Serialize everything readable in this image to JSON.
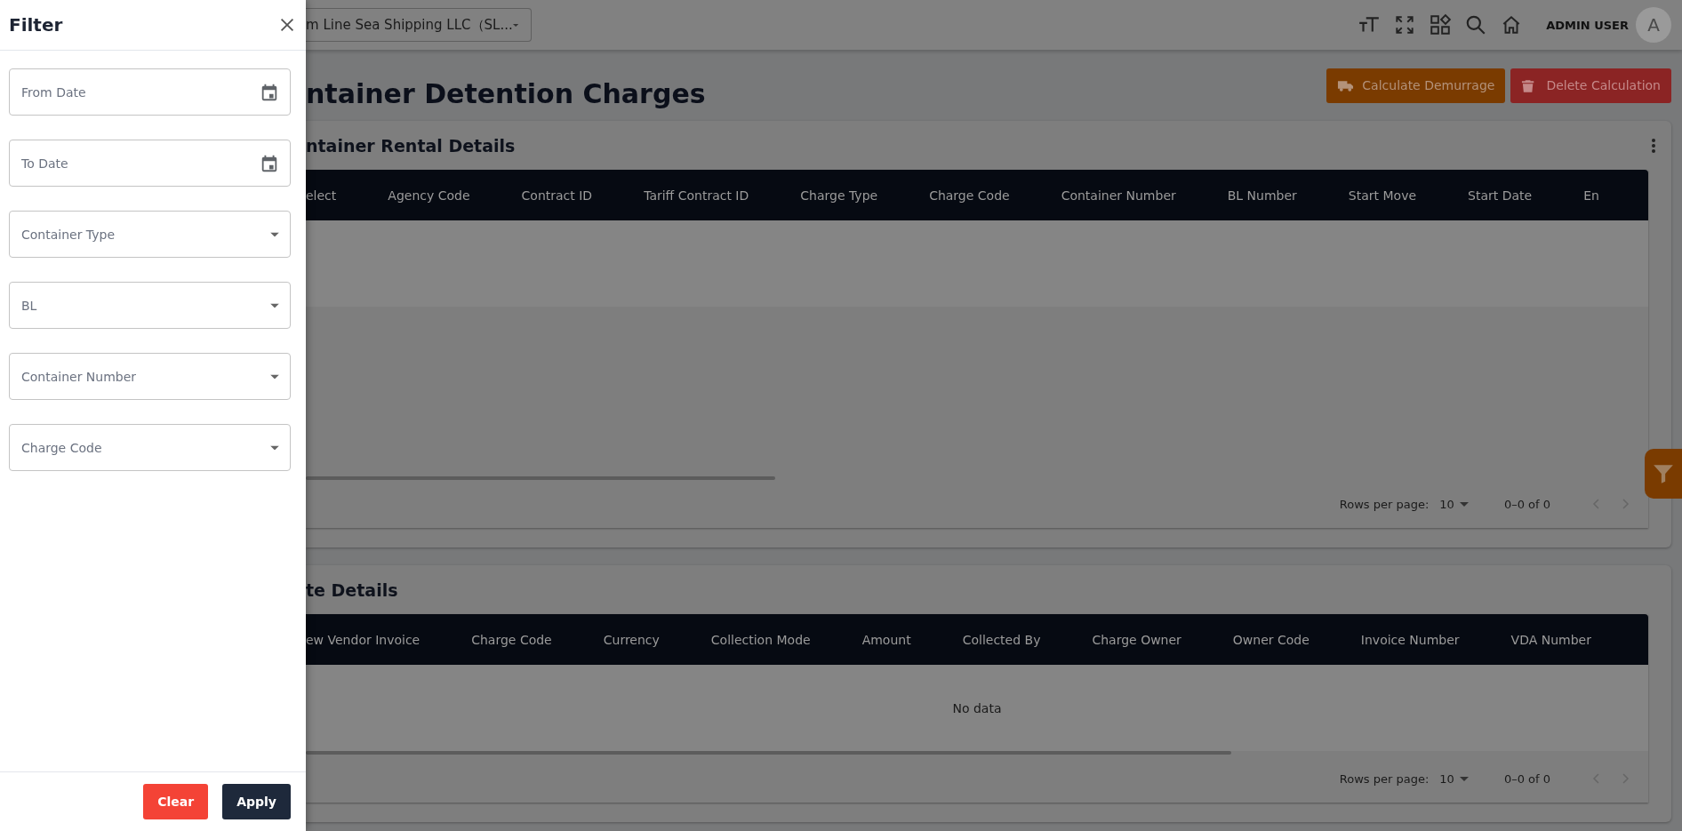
{
  "filter": {
    "title": "Filter",
    "fields": [
      {
        "kind": "date",
        "placeholder": "From Date"
      },
      {
        "kind": "date",
        "placeholder": "To Date"
      },
      {
        "kind": "select",
        "placeholder": "Container Type"
      },
      {
        "kind": "select",
        "placeholder": "BL"
      },
      {
        "kind": "select",
        "placeholder": "Container Number"
      },
      {
        "kind": "select",
        "placeholder": "Charge Code"
      }
    ],
    "buttons": [
      {
        "kind": "clear",
        "label": "Clear"
      },
      {
        "kind": "apply",
        "label": "Apply"
      }
    ]
  },
  "topbar": {
    "company": "m Line Sea Shipping LLC（SL...",
    "user": "ADMIN USER",
    "avatar": "A"
  },
  "page": {
    "title": "ntainer Detention Charges",
    "actions": [
      {
        "kind": "calculate",
        "label": "Calculate Demurrage"
      },
      {
        "kind": "delete",
        "label": "Delete Calculation"
      }
    ]
  },
  "cards": [
    {
      "title": "ntainer Rental Details",
      "menu": true,
      "columns": [
        "elect",
        "Agency Code",
        "Contract ID",
        "Tariff Contract ID",
        "Charge Type",
        "Charge Code",
        "Container Number",
        "BL Number",
        "Start Move",
        "Start Date",
        "En"
      ],
      "pagination": {
        "rows_label": "Rows per page:",
        "rows_value": "10",
        "range": "0–0 of 0"
      }
    },
    {
      "title": "te Details",
      "menu": false,
      "columns": [
        "ew Vendor Invoice",
        "Charge Code",
        "Currency",
        "Collection Mode",
        "Amount",
        "Collected By",
        "Charge Owner",
        "Owner Code",
        "Invoice Number",
        "VDA Number"
      ],
      "empty_text": "No data",
      "pagination": {
        "rows_label": "Rows per page:",
        "rows_value": "10",
        "range": "0–0 of 0"
      }
    }
  ]
}
